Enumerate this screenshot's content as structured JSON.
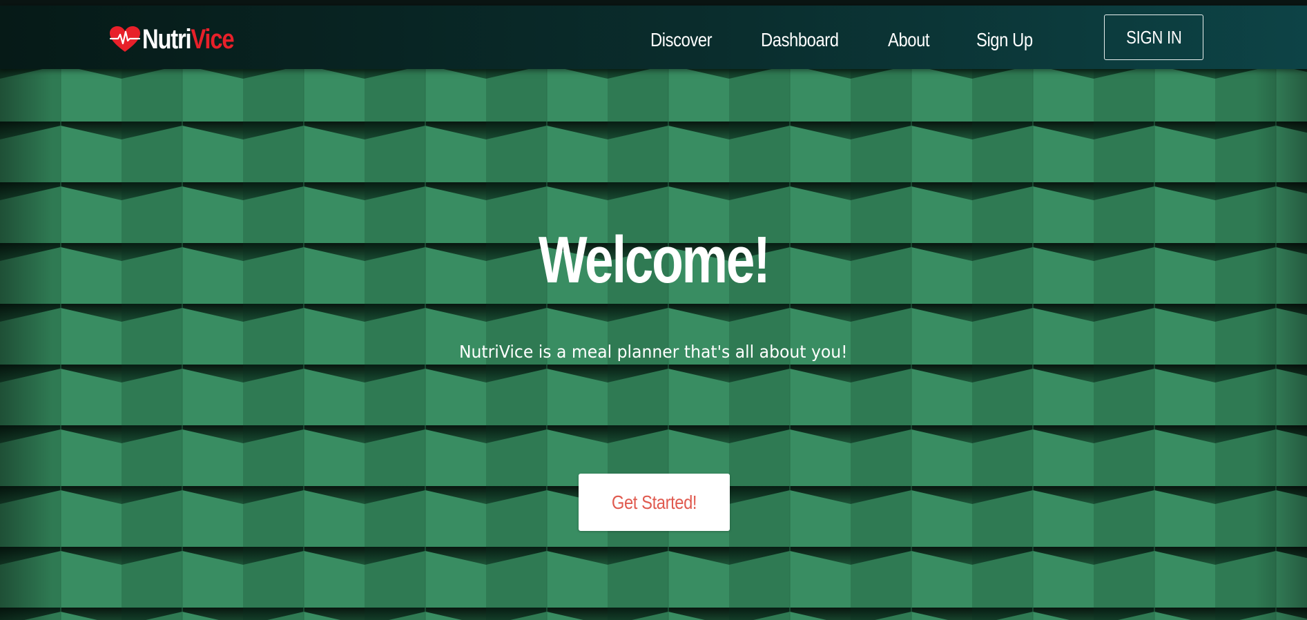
{
  "brand": {
    "name_part1": "Nutri",
    "name_part2": "Vice",
    "logo_icon": "heart-pulse-icon",
    "colors": {
      "part1": "#ffffff",
      "part2": "#e8202a"
    }
  },
  "nav": {
    "links": [
      {
        "label": "Discover"
      },
      {
        "label": "Dashboard"
      },
      {
        "label": "About"
      },
      {
        "label": "Sign Up"
      }
    ],
    "signin_label": "SIGN IN"
  },
  "hero": {
    "title": "Welcome!",
    "subtitle": "NutriVice is a meal planner that's all about you!",
    "cta_label": "Get Started!",
    "colors": {
      "background": "#2f7a53",
      "cta_text": "#e05a4f"
    }
  }
}
